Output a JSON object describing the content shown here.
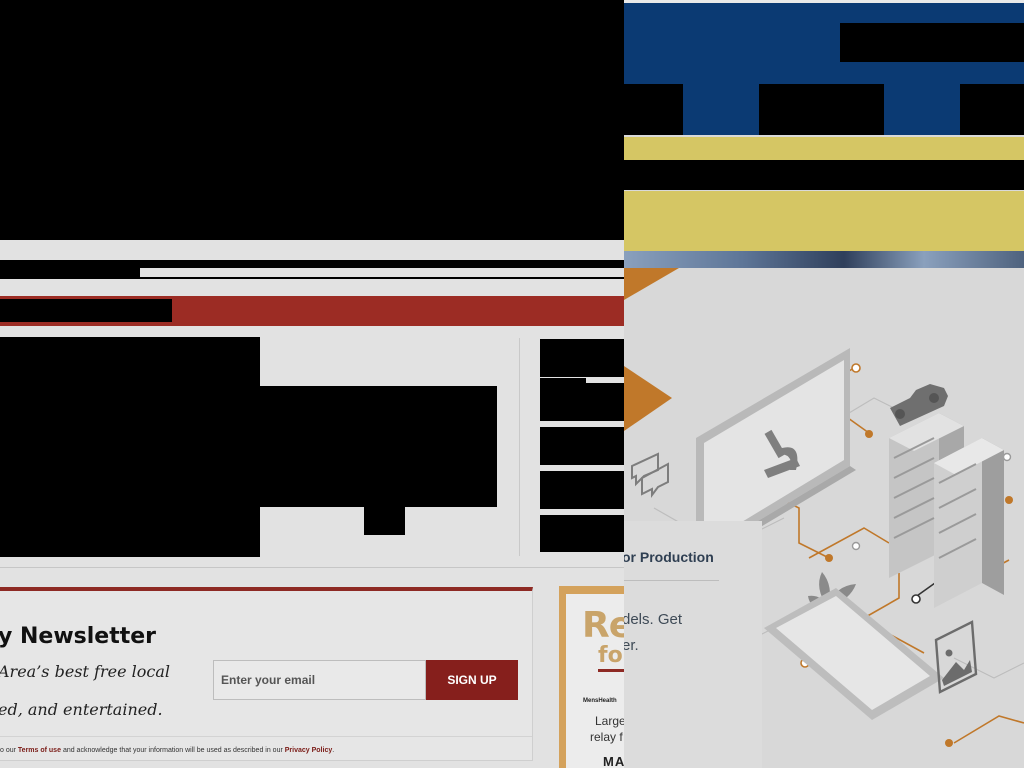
{
  "newsletter": {
    "title": "y Newsletter",
    "desc_line1": "Area’s best free local",
    "desc_line2": "ed, and entertained.",
    "email_placeholder": "Enter your email",
    "signup_label": "SIGN UP",
    "legal_prefix": "o our",
    "terms_link": "Terms of use",
    "legal_middle": "and acknowledge that your information will be used as described in our",
    "privacy_link": "Privacy Policy",
    "legal_suffix": "."
  },
  "side_ad": {
    "big_text": "Re",
    "big_text2": "fo",
    "logo_text": "MensHealth",
    "line1": "Large",
    "line2": "relay f",
    "month": "MA"
  },
  "right_panel": {
    "card_title": "or Production",
    "card_line1": "dels. Get",
    "card_line2": "er."
  },
  "colors": {
    "brand_red": "#9c2c24",
    "button_red": "#861f1c",
    "navy": "#0b3a73",
    "gold": "#d5c664",
    "accent_orange": "#c0782a"
  }
}
